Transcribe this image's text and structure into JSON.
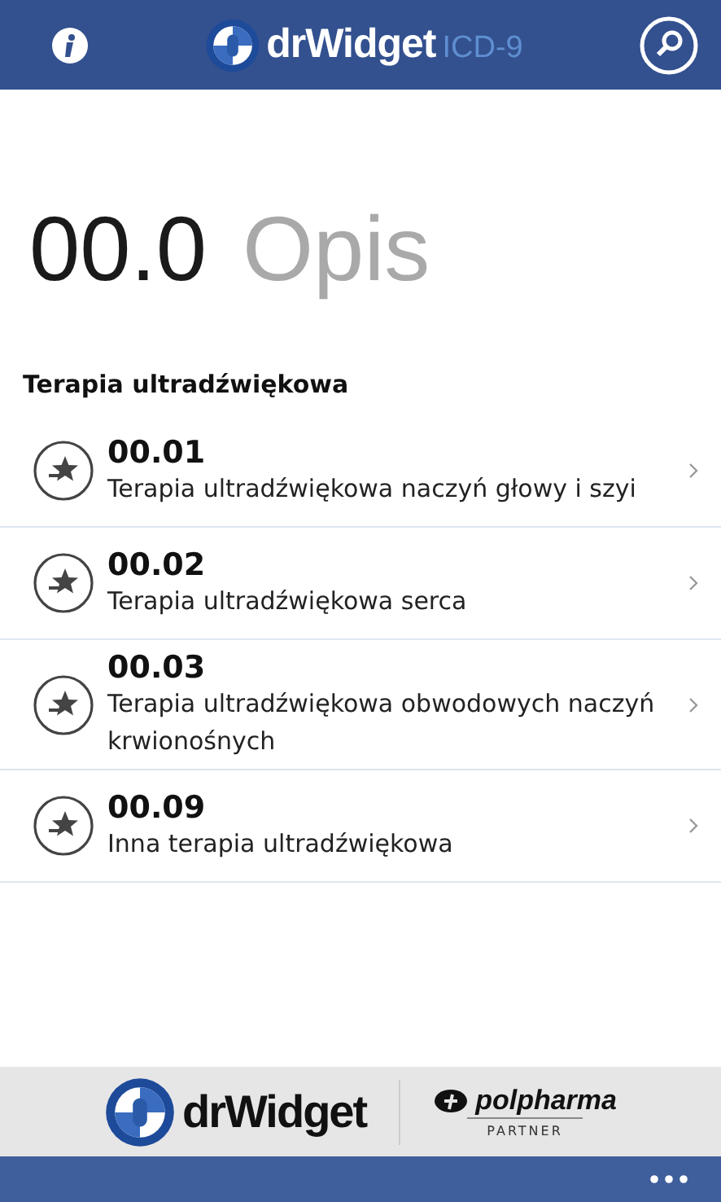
{
  "header": {
    "brand": "drWidget",
    "brand_suffix": "ICD-9"
  },
  "title": {
    "code": "00.0",
    "label": "Opis"
  },
  "section": "Terapia ultradźwiękowa",
  "items": [
    {
      "code": "00.01",
      "description": "Terapia ultradźwiękowa naczyń głowy i szyi"
    },
    {
      "code": "00.02",
      "description": "Terapia ultradźwiękowa serca"
    },
    {
      "code": "00.03",
      "description": "Terapia ultradźwiękowa obwodowych naczyń krwionośnych"
    },
    {
      "code": "00.09",
      "description": "Inna terapia ultradźwiękowa"
    }
  ],
  "footer": {
    "brand": "drWidget",
    "partner_name": "polpharma",
    "partner_label": "PARTNER"
  }
}
